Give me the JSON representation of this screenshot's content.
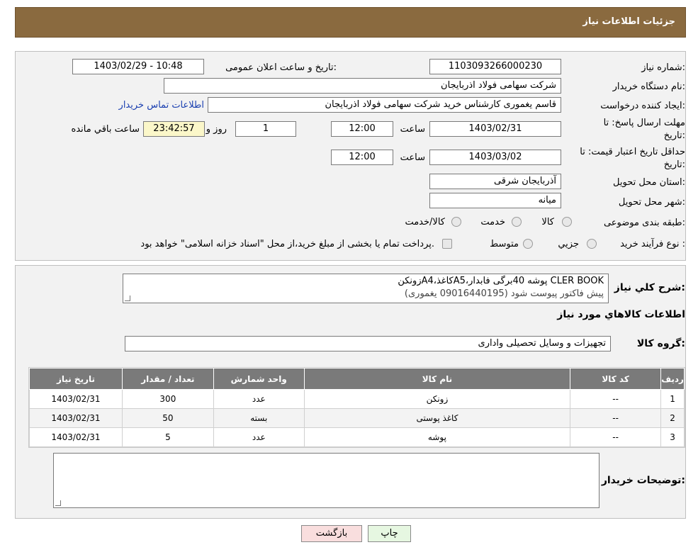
{
  "header": {
    "title": "جزئیات اطلاعات نیاز"
  },
  "form": {
    "need_number_label": "شماره نیاز:",
    "need_number": "1103093266000230",
    "announce_label": "تاریخ و ساعت اعلان عمومی:",
    "announce_value": "1403/02/29 - 10:48",
    "buyer_org_label": "نام دستگاه خریدار:",
    "buyer_org": "شرکت سهامی فولاد اذربایجان",
    "creator_label": "ایجاد کننده درخواست:",
    "creator": "قاسم یغموری کارشناس خرید شرکت سهامی فولاد اذربایجان",
    "contact_link": "اطلاعات تماس خریدار",
    "deadline_label_1": "مهلت ارسال پاسخ: تا",
    "deadline_label_2": "تاریخ:",
    "deadline_date": "1403/02/31",
    "time_label": "ساعت",
    "deadline_time": "12:00",
    "days_value": "1",
    "days_label": "روز و",
    "remaining_time": "23:42:57",
    "remaining_label": "ساعت باقي مانده",
    "validity_label_1": "حداقل تاریخ اعتبار قیمت: تا",
    "validity_label_2": "تاریخ:",
    "validity_date": "1403/03/02",
    "validity_time": "12:00",
    "province_label": "استان محل تحویل:",
    "province": "آذربایجان شرقی",
    "city_label": "شهر محل تحویل:",
    "city": "میانه",
    "category_label": "طبقه بندی موضوعی:",
    "category_options": [
      "کالا",
      "خدمت",
      "کالا/خدمت"
    ],
    "process_label": "نوع فرآیند خرید :",
    "process_options": [
      "جزیي",
      "متوسط"
    ],
    "process_note": "پرداخت تمام یا بخشی از مبلغ خرید،از محل \"اسناد خزانه اسلامی\" خواهد بود."
  },
  "details": {
    "desc_label": "شرح کلي نیاز:",
    "desc_line1": "زونکنA4،کاغذA5،پوشه 40برگی فابدار CLER BOOK",
    "desc_line2": "پیش فاکتور پیوست شود (09016440195 یغموری)",
    "goods_info_title": "اطلاعات کالاهاي مورد نیاز",
    "goods_group_label": "گروه کالا:",
    "goods_group": "تجهیزات و وسایل تحصیلی واداری",
    "table": {
      "headers": [
        "ردیف",
        "کد کالا",
        "نام کالا",
        "واحد شمارش",
        "تعداد / مقدار",
        "تاریخ نیاز"
      ],
      "rows": [
        [
          "1",
          "--",
          "زونکن",
          "عدد",
          "300",
          "1403/02/31"
        ],
        [
          "2",
          "--",
          "کاغذ پوستی",
          "بسته",
          "50",
          "1403/02/31"
        ],
        [
          "3",
          "--",
          "پوشه",
          "عدد",
          "5",
          "1403/02/31"
        ]
      ]
    },
    "buyer_notes_label": "توضیحات خریدار:"
  },
  "buttons": {
    "print": "چاپ",
    "back": "بازگشت"
  },
  "colors": {
    "header_bg": "#8a6a3f",
    "table_header_bg": "#7a7a7a",
    "back_btn_bg": "#f9dede",
    "print_btn_bg": "#e6f7e1"
  }
}
